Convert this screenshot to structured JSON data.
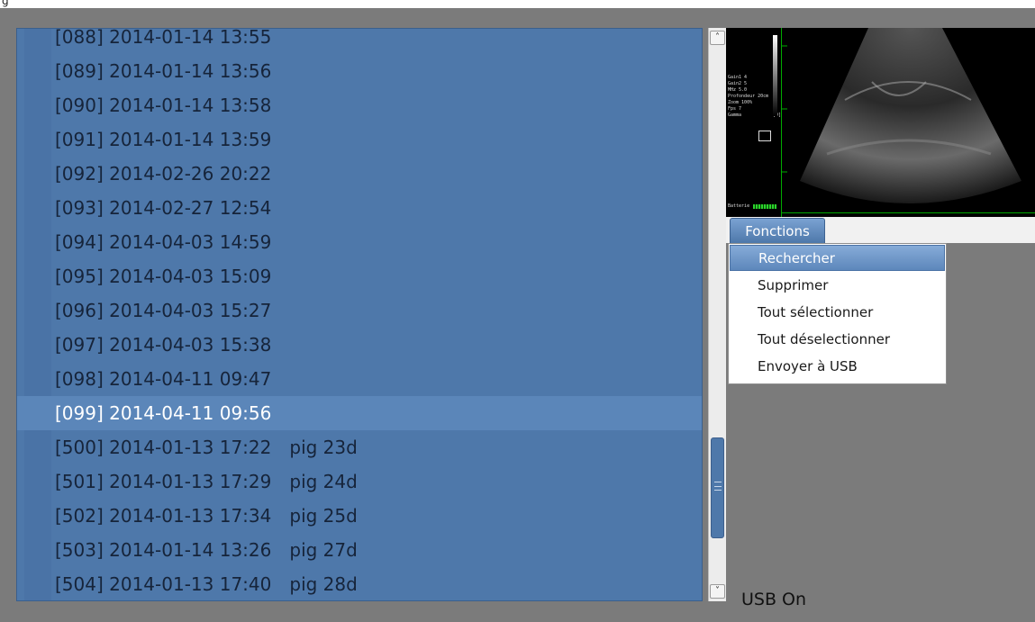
{
  "page": {
    "title": "g"
  },
  "file_list": {
    "rows": [
      {
        "label": "[088] 2014-01-14 13:55",
        "tag": ""
      },
      {
        "label": "[089] 2014-01-14 13:56",
        "tag": ""
      },
      {
        "label": "[090] 2014-01-14 13:58",
        "tag": ""
      },
      {
        "label": "[091] 2014-01-14 13:59",
        "tag": ""
      },
      {
        "label": "[092] 2014-02-26 20:22",
        "tag": ""
      },
      {
        "label": "[093] 2014-02-27 12:54",
        "tag": ""
      },
      {
        "label": "[094] 2014-04-03 14:59",
        "tag": ""
      },
      {
        "label": "[095] 2014-04-03 15:09",
        "tag": ""
      },
      {
        "label": "[096] 2014-04-03 15:27",
        "tag": ""
      },
      {
        "label": "[097] 2014-04-03 15:38",
        "tag": ""
      },
      {
        "label": "[098] 2014-04-11 09:47",
        "tag": ""
      },
      {
        "label": "[099] 2014-04-11 09:56",
        "tag": "",
        "selected": true
      },
      {
        "label": "[500] 2014-01-13 17:22",
        "tag": "pig 23d"
      },
      {
        "label": "[501] 2014-01-13 17:29",
        "tag": "pig 24d"
      },
      {
        "label": "[502] 2014-01-13 17:34",
        "tag": "pig 25d"
      },
      {
        "label": "[503] 2014-01-14 13:26",
        "tag": "pig 27d"
      },
      {
        "label": "[504] 2014-01-13 17:40",
        "tag": "pig 28d"
      }
    ]
  },
  "viewer": {
    "info_lines": [
      "Gain1 4",
      "Gain2 5",
      "MHz 5.0",
      "Profondeur 20cm",
      "Zoom 100%",
      "Fps 7",
      "Gamma"
    ],
    "gamma_value": "[9]",
    "battery_label": "Batterie"
  },
  "menu": {
    "tab_label": "Fonctions",
    "items": [
      {
        "label": "Rechercher",
        "active": true
      },
      {
        "label": "Supprimer"
      },
      {
        "label": "Tout sélectionner"
      },
      {
        "label": "Tout déselectionner"
      },
      {
        "label": "Envoyer à USB"
      }
    ]
  },
  "status": {
    "usb": "USB On"
  },
  "colors": {
    "list_bg": "#4e78aa",
    "selected_row": "#5b86b9",
    "background": "#7b7b7b"
  }
}
